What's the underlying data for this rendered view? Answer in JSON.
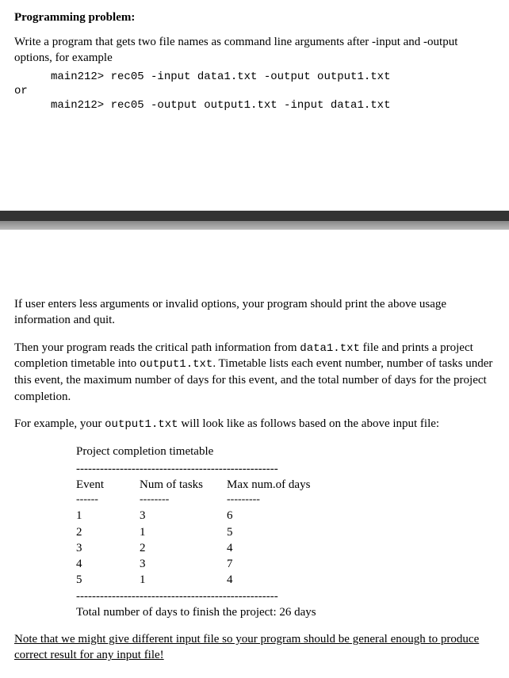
{
  "section1": {
    "heading": "Programming problem:",
    "intro": "Write a program that gets two file names as command line arguments after -input and -output options, for example",
    "code1": "main212> rec05 -input data1.txt -output output1.txt",
    "or_text": "or",
    "code2": "main212> rec05 -output output1.txt -input data1.txt"
  },
  "section2": {
    "para1": "If user enters less arguments or invalid options, your program should print the above usage information and quit.",
    "para2_a": "Then your program reads the critical path information from ",
    "para2_code1": "data1.txt",
    "para2_b": " file and prints a project completion timetable into ",
    "para2_code2": "output1.txt",
    "para2_c": ". Timetable lists each event number, number of tasks under this event, the maximum number of days for this event, and the total number of days for the project completion.",
    "para3_a": "For example, your ",
    "para3_code": "output1.txt",
    "para3_b": " will look like as follows based on the above input file:",
    "table": {
      "title": "Project completion timetable",
      "dash_long": "---------------------------------------------------",
      "header_event": "Event",
      "header_tasks": "Num of tasks",
      "header_days": "Max num.of days",
      "sub_dash1": "------",
      "sub_dash2": "--------",
      "sub_dash3": "---------",
      "rows": [
        {
          "event": "1",
          "tasks": "3",
          "days": "6"
        },
        {
          "event": "2",
          "tasks": "1",
          "days": "5"
        },
        {
          "event": "3",
          "tasks": "2",
          "days": "4"
        },
        {
          "event": "4",
          "tasks": "3",
          "days": "7"
        },
        {
          "event": "5",
          "tasks": "1",
          "days": "4"
        }
      ],
      "dash_long2": "---------------------------------------------------",
      "total_line": "Total number of days to finish the project: 26 days"
    },
    "note": "Note that we might give different input file so your program should be general enough to produce correct result for any input file!"
  }
}
